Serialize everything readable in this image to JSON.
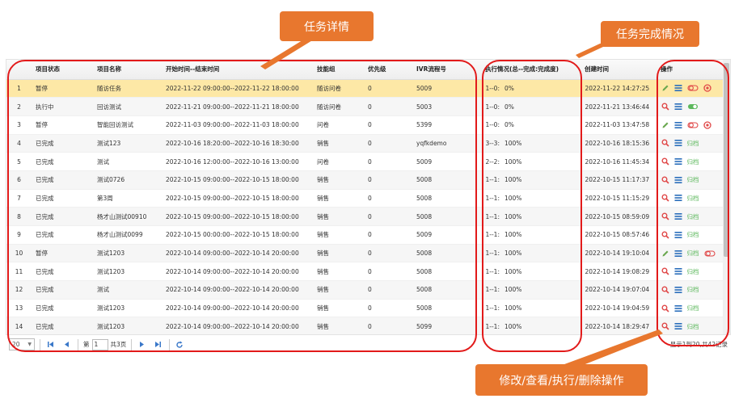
{
  "columns": [
    "",
    "项目状态",
    "项目名称",
    "开始时间--结束时间",
    "技能组",
    "优先级",
    "IVR流程号",
    "执行情况(总--完成:完成度)",
    "创建时间",
    "操作"
  ],
  "rows": [
    {
      "n": "1",
      "status": "暂停",
      "name": "随访任务",
      "time": "2022-11-22 09:00:00--2022-11-22 18:00:00",
      "skill": "随访问卷",
      "priority": "0",
      "ivr": "5009",
      "exec": "1--0:",
      "pct": "0%",
      "created": "2022-11-22 14:27:25",
      "ops": "edit-run"
    },
    {
      "n": "2",
      "status": "执行中",
      "name": "回访测试",
      "time": "2022-11-21 09:00:00--2022-11-21 18:00:00",
      "skill": "随访问卷",
      "priority": "0",
      "ivr": "5003",
      "exec": "1--0:",
      "pct": "0%",
      "created": "2022-11-21 13:46:44",
      "ops": "view-running"
    },
    {
      "n": "3",
      "status": "暂停",
      "name": "智能回访测试",
      "time": "2022-11-03 09:00:00--2022-11-03 18:00:00",
      "skill": "问卷",
      "priority": "0",
      "ivr": "5399",
      "exec": "1--0:",
      "pct": "0%",
      "created": "2022-11-03 13:47:58",
      "ops": "edit-run"
    },
    {
      "n": "4",
      "status": "已完成",
      "name": "测试123",
      "time": "2022-10-16 18:20:00--2022-10-16 18:30:00",
      "skill": "销售",
      "priority": "0",
      "ivr": "yqfkdemo",
      "exec": "3--3:",
      "pct": "100%",
      "created": "2022-10-16 18:15:36",
      "ops": "archive"
    },
    {
      "n": "5",
      "status": "已完成",
      "name": "测试",
      "time": "2022-10-16 12:00:00--2022-10-16 13:00:00",
      "skill": "问卷",
      "priority": "0",
      "ivr": "5009",
      "exec": "2--2:",
      "pct": "100%",
      "created": "2022-10-16 11:45:34",
      "ops": "archive"
    },
    {
      "n": "6",
      "status": "已完成",
      "name": "测试0726",
      "time": "2022-10-15 09:00:00--2022-10-15 18:00:00",
      "skill": "销售",
      "priority": "0",
      "ivr": "5008",
      "exec": "1--1:",
      "pct": "100%",
      "created": "2022-10-15 11:17:37",
      "ops": "archive"
    },
    {
      "n": "7",
      "status": "已完成",
      "name": "第3周",
      "time": "2022-10-15 09:00:00--2022-10-15 18:00:00",
      "skill": "销售",
      "priority": "0",
      "ivr": "5008",
      "exec": "1--1:",
      "pct": "100%",
      "created": "2022-10-15 11:15:29",
      "ops": "archive"
    },
    {
      "n": "8",
      "status": "已完成",
      "name": "杨才山测试00910",
      "time": "2022-10-15 09:00:00--2022-10-15 18:00:00",
      "skill": "销售",
      "priority": "0",
      "ivr": "5008",
      "exec": "1--1:",
      "pct": "100%",
      "created": "2022-10-15 08:59:09",
      "ops": "archive"
    },
    {
      "n": "9",
      "status": "已完成",
      "name": "杨才山测试0099",
      "time": "2022-10-15 00:00:00--2022-10-15 18:00:00",
      "skill": "销售",
      "priority": "0",
      "ivr": "5009",
      "exec": "1--1:",
      "pct": "100%",
      "created": "2022-10-15 08:57:46",
      "ops": "archive"
    },
    {
      "n": "10",
      "status": "暂停",
      "name": "测试1203",
      "time": "2022-10-14 09:00:00--2022-10-14 20:00:00",
      "skill": "销售",
      "priority": "0",
      "ivr": "5008",
      "exec": "1--1:",
      "pct": "100%",
      "created": "2022-10-14 19:10:04",
      "ops": "edit-archive"
    },
    {
      "n": "11",
      "status": "已完成",
      "name": "测试1203",
      "time": "2022-10-14 09:00:00--2022-10-14 20:00:00",
      "skill": "销售",
      "priority": "0",
      "ivr": "5008",
      "exec": "1--1:",
      "pct": "100%",
      "created": "2022-10-14 19:08:29",
      "ops": "archive"
    },
    {
      "n": "12",
      "status": "已完成",
      "name": "测试",
      "time": "2022-10-14 09:00:00--2022-10-14 20:00:00",
      "skill": "销售",
      "priority": "0",
      "ivr": "5008",
      "exec": "1--1:",
      "pct": "100%",
      "created": "2022-10-14 19:07:04",
      "ops": "archive"
    },
    {
      "n": "13",
      "status": "已完成",
      "name": "测试1203",
      "time": "2022-10-14 09:00:00--2022-10-14 20:00:00",
      "skill": "销售",
      "priority": "0",
      "ivr": "5008",
      "exec": "1--1:",
      "pct": "100%",
      "created": "2022-10-14 19:04:59",
      "ops": "archive"
    },
    {
      "n": "14",
      "status": "已完成",
      "name": "测试1203",
      "time": "2022-10-14 09:00:00--2022-10-14 20:00:00",
      "skill": "销售",
      "priority": "0",
      "ivr": "5099",
      "exec": "1--1:",
      "pct": "100%",
      "created": "2022-10-14 18:29:47",
      "ops": "archive"
    }
  ],
  "archive_label": "归档",
  "pager": {
    "page_size": "20",
    "page_prefix": "第",
    "page_value": "1",
    "page_total": "共3页",
    "info": "显示1到20,共42记录"
  },
  "callouts": {
    "task_detail": "任务详情",
    "task_completion": "任务完成情况",
    "operations": "修改/查看/执行/删除操作"
  },
  "icons": [
    "edit-icon",
    "search-icon",
    "list-icon",
    "run-toggle-icon",
    "delete-icon",
    "running-toggle-icon",
    "first-page-icon",
    "prev-page-icon",
    "next-page-icon",
    "last-page-icon",
    "refresh-icon"
  ],
  "colors": {
    "selected_row": "#fde8a6",
    "callout": "#e8772e",
    "annotation": "#e21a1a",
    "archive": "#5cb85c",
    "icon_blue": "#2a6ebb",
    "icon_red": "#e04848"
  }
}
